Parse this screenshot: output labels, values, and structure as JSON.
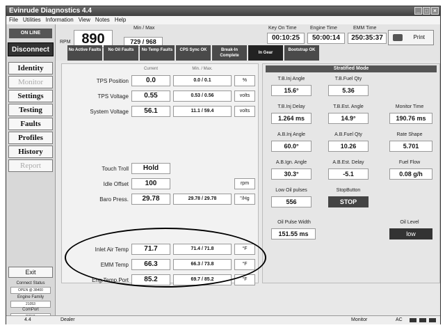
{
  "window": {
    "title": "Evinrude Diagnostics 4.4"
  },
  "menu": [
    "File",
    "Utilities",
    "Information",
    "View",
    "Notes",
    "Help"
  ],
  "sidebar": {
    "online": "ON LINE",
    "disconnect": "Disconnect",
    "nav": [
      "Identity",
      "Monitor",
      "Settings",
      "Testing",
      "Faults",
      "Profiles",
      "History",
      "Report"
    ],
    "exit": "Exit",
    "connect_status_label": "Connect Status",
    "connect_status_value": "OPEN @ 38400",
    "engine_family_label": "Engine Family",
    "engine_family_value": "21053",
    "comport_label": "ComPort",
    "comport_value": "COM1"
  },
  "header": {
    "rpm_label": "RPM",
    "rpm_value": "890",
    "minmax_label": "Min / Max",
    "minmax_value": "729 / 968",
    "key_on_label": "Key On Time",
    "key_on_value": "00:10:25",
    "engine_time_label": "Engine Time",
    "engine_time_value": "50:00:14",
    "emm_time_label": "EMM Time",
    "emm_time_value": "250:35:37",
    "print_label": "Print"
  },
  "status_buttons": [
    "No Active Faults",
    "No Oil Faults",
    "No Temp Faults",
    "CPS Sync OK",
    "Break-In Complete",
    "In Gear",
    "Bootstrap OK"
  ],
  "left_panel": {
    "col_current": "Current",
    "col_minmax": "Min. / Max.",
    "rows_top": [
      {
        "label": "TPS Position",
        "value": "0.0",
        "minmax": "0.0 / 0.1",
        "unit": "%"
      },
      {
        "label": "TPS Voltage",
        "value": "0.55",
        "minmax": "0.53 / 0.56",
        "unit": "volts"
      },
      {
        "label": "System Voltage",
        "value": "56.1",
        "minmax": "11.1 / 59.4",
        "unit": "volts"
      }
    ],
    "touch_troll_label": "Touch Troll",
    "touch_troll_value": "Hold",
    "idle_offset_label": "Idle Offset",
    "idle_offset_value": "100",
    "idle_offset_unit": "rpm",
    "baro_label": "Baro Press.",
    "baro_value": "29.78",
    "baro_minmax": "29.78 / 29.78",
    "baro_unit": "\"/Hg",
    "rows_temp": [
      {
        "label": "Inlet Air Temp",
        "value": "71.7",
        "minmax": "71.4 / 71.8",
        "unit": "°F"
      },
      {
        "label": "EMM Temp",
        "value": "66.3",
        "minmax": "66.3 / 73.8",
        "unit": "°F"
      },
      {
        "label": "Eng.Temp.Port",
        "value": "85.2",
        "minmax": "69.7 / 85.2",
        "unit": "°F"
      }
    ]
  },
  "right_panel": {
    "title": "Stratified Mode",
    "tb_inj_angle_label": "T.B.Inj Angle",
    "tb_inj_angle": "15.6°",
    "tb_fuel_qty_label": "T.B.Fuel Qty",
    "tb_fuel_qty": "5.36",
    "tb_inj_delay_label": "T.B.Inj Delay",
    "tb_inj_delay": "1.264 ms",
    "tb_est_angle_label": "T.B.Est. Angle",
    "tb_est_angle": "14.9°",
    "monitor_time_label": "Monitor Time",
    "monitor_time": "190.76 ms",
    "ab_inj_angle_label": "A.B.Inj Angle",
    "ab_inj_angle": "60.0°",
    "ab_fuel_qty_label": "A.B.Fuel Qty",
    "ab_fuel_qty": "10.26",
    "rate_shape_label": "Rate Shape",
    "rate_shape": "5.701",
    "ab_ign_angle_label": "A.B.Ign. Angle",
    "ab_ign_angle": "30.3°",
    "ab_est_delay_label": "A.B.Est. Delay",
    "ab_est_delay": "-5.1",
    "fuel_flow_label": "Fuel Flow",
    "fuel_flow": "0.08 g/h",
    "low_oil_label": "Low Oil pulses",
    "low_oil": "556",
    "stop_label": "StopButton",
    "stop_value": "STOP",
    "oil_pulse_label": "Oil Pulse Width",
    "oil_pulse": "151.55 ms",
    "oil_level_label": "Oil Level",
    "oil_level": "low"
  },
  "statusbar": {
    "version": "4.4",
    "mode": "Dealer",
    "monitor": "Monitor",
    "ac": "AC"
  }
}
